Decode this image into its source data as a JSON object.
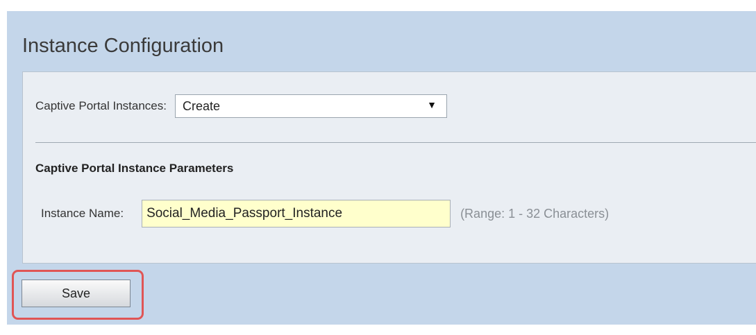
{
  "page": {
    "title": "Instance Configuration"
  },
  "instances": {
    "label": "Captive Portal Instances:",
    "selected": "Create",
    "arrow_icon": "dropdown-arrow"
  },
  "parameters": {
    "heading": "Captive Portal Instance Parameters",
    "instance_name_label": "Instance Name:",
    "instance_name_value": "Social_Media_Passport_Instance",
    "range_hint": "(Range: 1 - 32 Characters)"
  },
  "actions": {
    "save_label": "Save"
  },
  "colors": {
    "background": "#c4d6ea",
    "panel": "#eaeef3",
    "input_highlight": "#ffffcc",
    "annotation": "#e05555"
  }
}
